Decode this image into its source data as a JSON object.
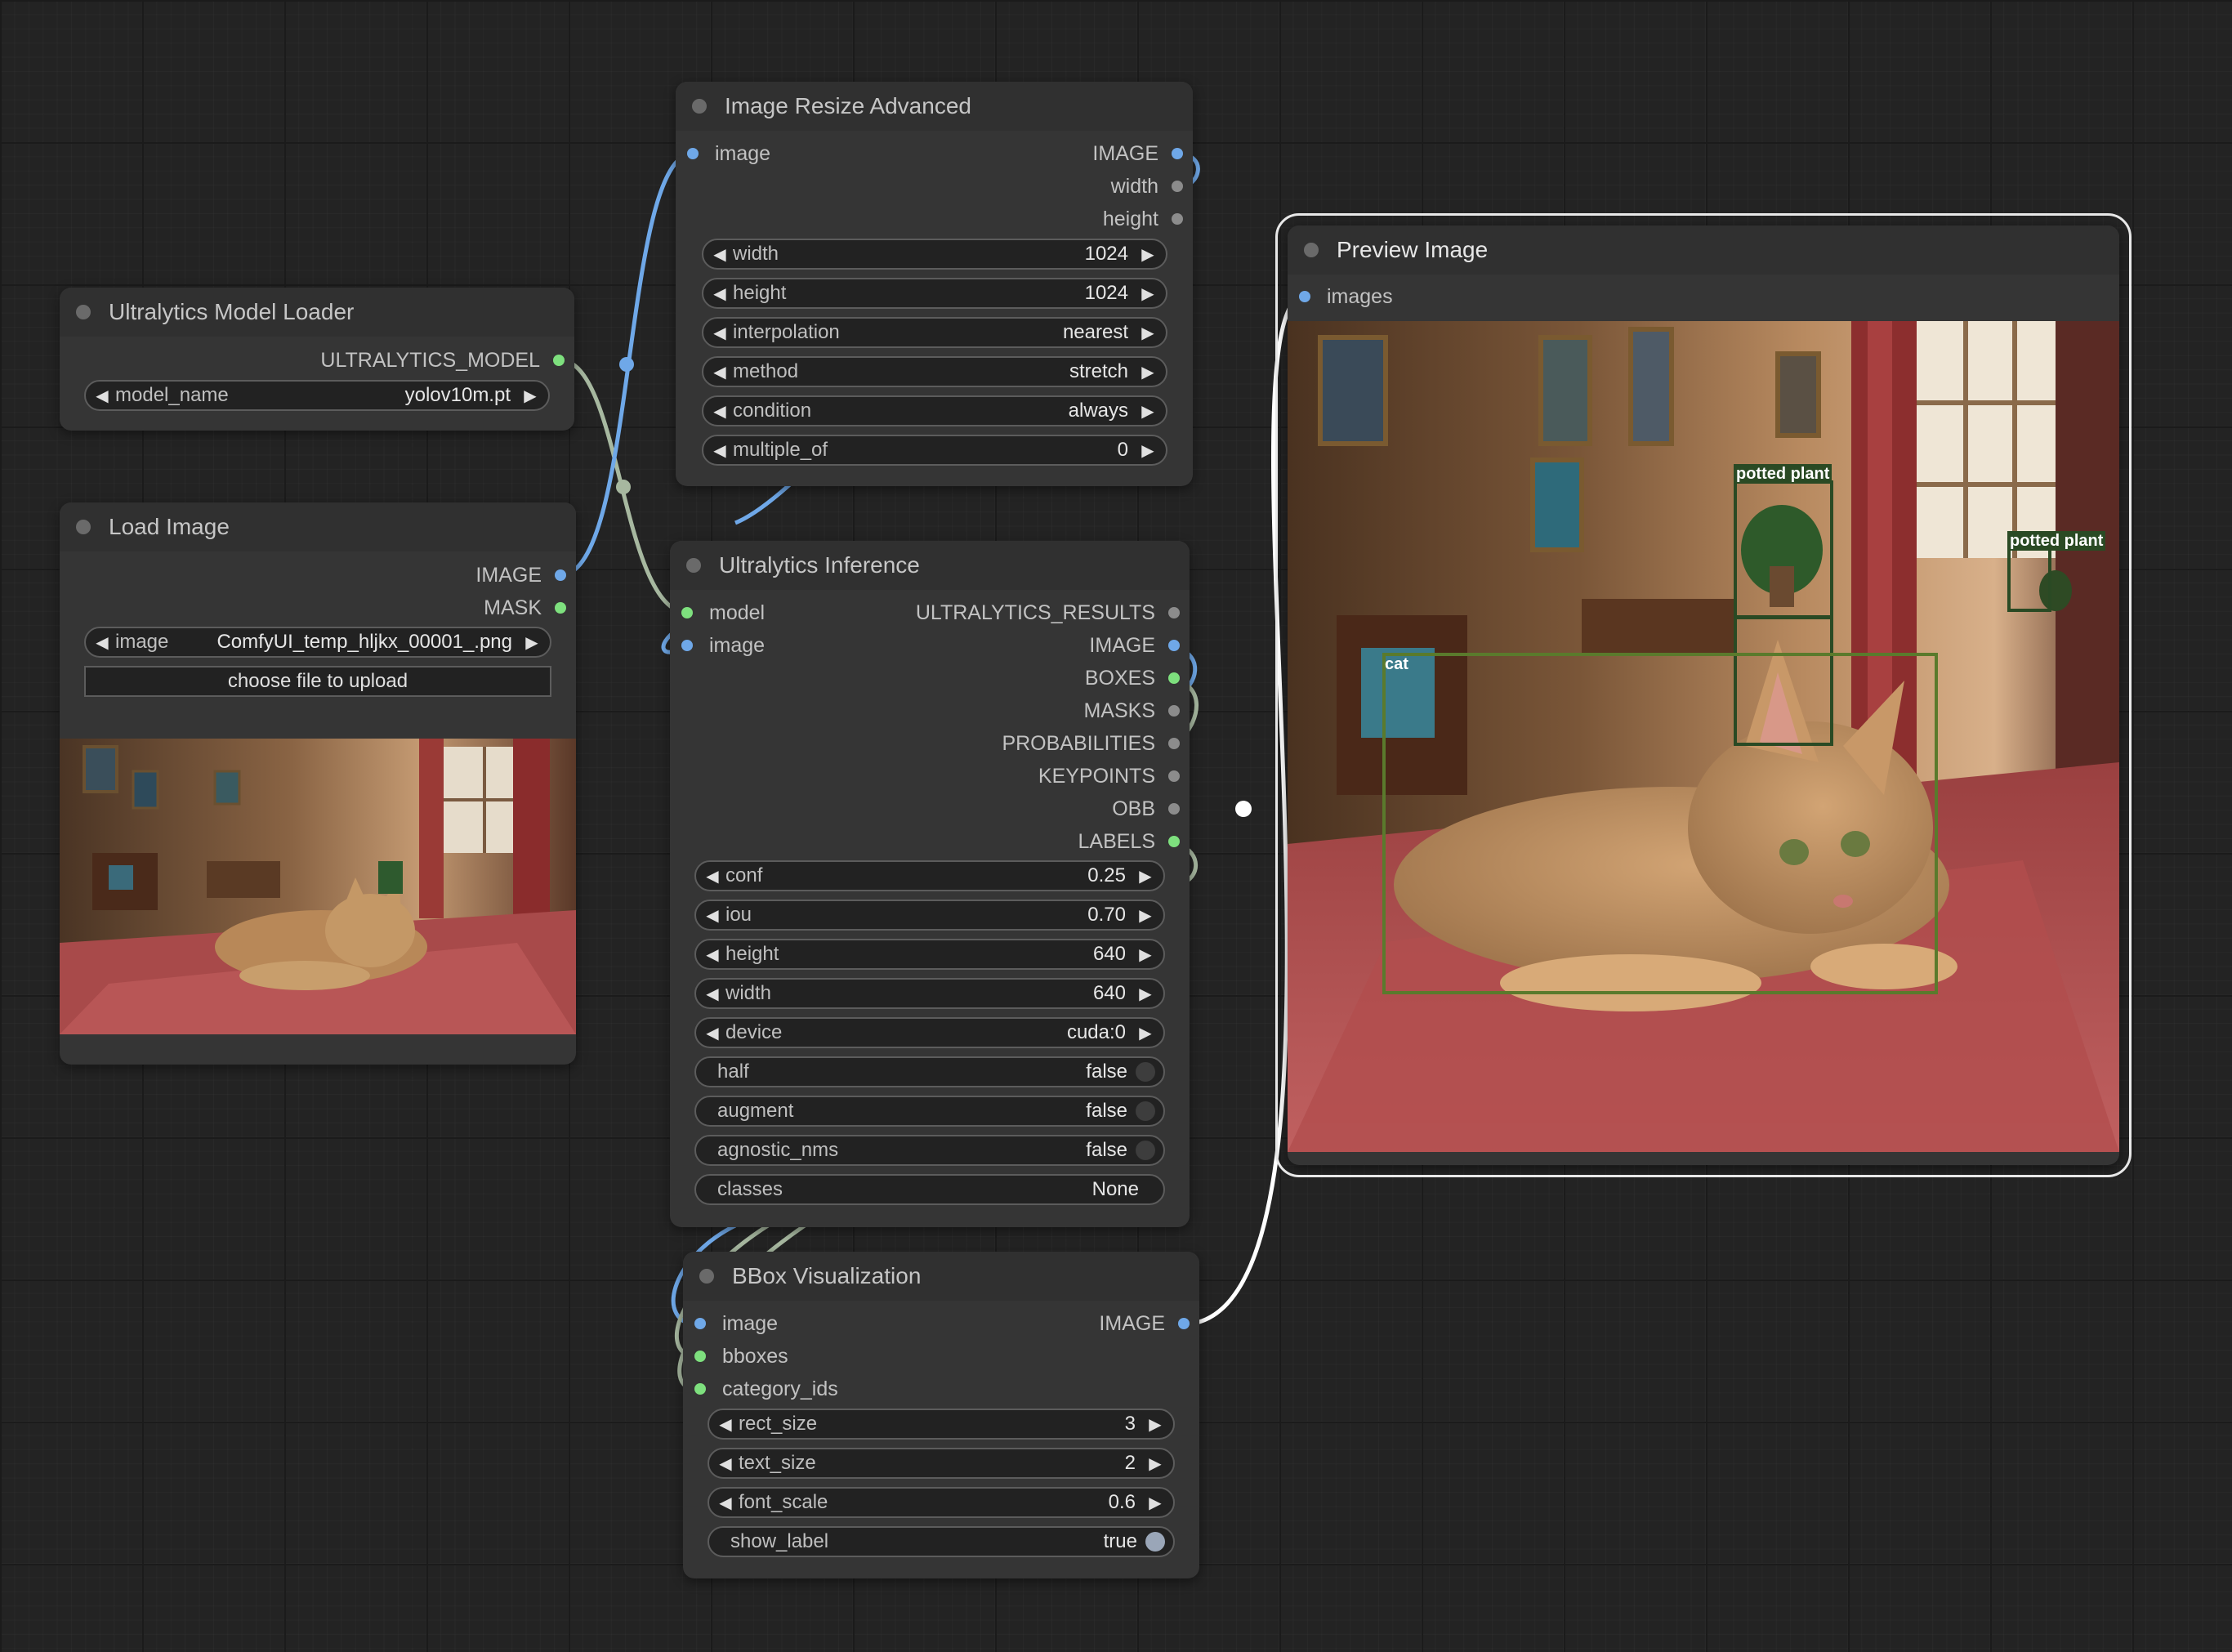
{
  "nodes": {
    "model_loader": {
      "title": "Ultralytics Model Loader",
      "output": "ULTRALYTICS_MODEL",
      "widget_model_name": {
        "name": "model_name",
        "value": "yolov10m.pt"
      }
    },
    "load_image": {
      "title": "Load Image",
      "outputs": [
        "IMAGE",
        "MASK"
      ],
      "widget_image": {
        "name": "image",
        "value": "ComfyUI_temp_hljkx_00001_.png"
      },
      "upload_label": "choose file to upload"
    },
    "resize": {
      "title": "Image Resize Advanced",
      "input": "image",
      "outputs": [
        "IMAGE",
        "width",
        "height"
      ],
      "widgets": [
        {
          "name": "width",
          "value": "1024"
        },
        {
          "name": "height",
          "value": "1024"
        },
        {
          "name": "interpolation",
          "value": "nearest"
        },
        {
          "name": "method",
          "value": "stretch"
        },
        {
          "name": "condition",
          "value": "always"
        },
        {
          "name": "multiple_of",
          "value": "0"
        }
      ]
    },
    "inference": {
      "title": "Ultralytics Inference",
      "inputs": [
        "model",
        "image"
      ],
      "outputs": [
        "ULTRALYTICS_RESULTS",
        "IMAGE",
        "BOXES",
        "MASKS",
        "PROBABILITIES",
        "KEYPOINTS",
        "OBB",
        "LABELS"
      ],
      "widgets": [
        {
          "name": "conf",
          "value": "0.25"
        },
        {
          "name": "iou",
          "value": "0.70"
        },
        {
          "name": "height",
          "value": "640"
        },
        {
          "name": "width",
          "value": "640"
        },
        {
          "name": "device",
          "value": "cuda:0"
        }
      ],
      "toggles": [
        {
          "name": "half",
          "value": "false"
        },
        {
          "name": "augment",
          "value": "false"
        },
        {
          "name": "agnostic_nms",
          "value": "false"
        }
      ],
      "classes": {
        "name": "classes",
        "value": "None"
      }
    },
    "bbox_vis": {
      "title": "BBox Visualization",
      "inputs": [
        "image",
        "bboxes",
        "category_ids"
      ],
      "output": "IMAGE",
      "widgets": [
        {
          "name": "rect_size",
          "value": "3"
        },
        {
          "name": "text_size",
          "value": "2"
        },
        {
          "name": "font_scale",
          "value": "0.6"
        }
      ],
      "toggle": {
        "name": "show_label",
        "value": "true"
      }
    },
    "preview": {
      "title": "Preview Image",
      "input": "images",
      "detections": [
        "potted plant",
        "potted plant",
        "cat"
      ]
    }
  },
  "colors": {
    "image_slot": "#6fa8e8",
    "model_slot": "#7ee07e",
    "other_slot": "#8c8c8c",
    "link_image": "#6fa8e8",
    "link_model": "#a7b8a0",
    "link_selected": "#ffffff",
    "bbox_plant": "#2f5a2a",
    "bbox_cat": "#5a7a2c"
  }
}
